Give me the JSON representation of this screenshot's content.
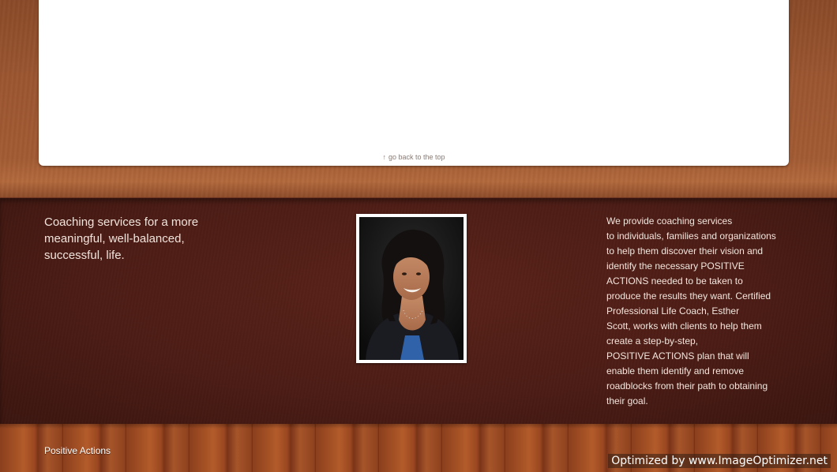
{
  "content": {
    "back_to_top_icon": "up-arrow-icon",
    "back_to_top_arrow": "↑",
    "back_to_top_label": "go back to the top"
  },
  "footer": {
    "tagline": "Coaching services for a more\nmeaningful, well-balanced,\nsuccessful,  life.",
    "photo_alt": "Esther Scott",
    "description": "We provide coaching services\nto individuals, families and organizations\nto help them discover their vision and\nidentify the necessary POSITIVE\nACTIONS needed to be taken to\nproduce the results they want. Certified\nProfessional Life Coach, Esther\nScott, works with clients to help them\ncreate a step-by-step,\nPOSITIVE ACTIONS  plan that will\nenable them identify and remove\nroadblocks from their path to obtaining\ntheir goal."
  },
  "bottom_bar": {
    "brand": "Positive Actions",
    "watermark": "Optimized by www.ImageOptimizer.net"
  },
  "colors": {
    "leather_top": "#a35b33",
    "leather_dark": "#4c1c15",
    "wood": "#a24f24",
    "panel": "#ffffff"
  }
}
